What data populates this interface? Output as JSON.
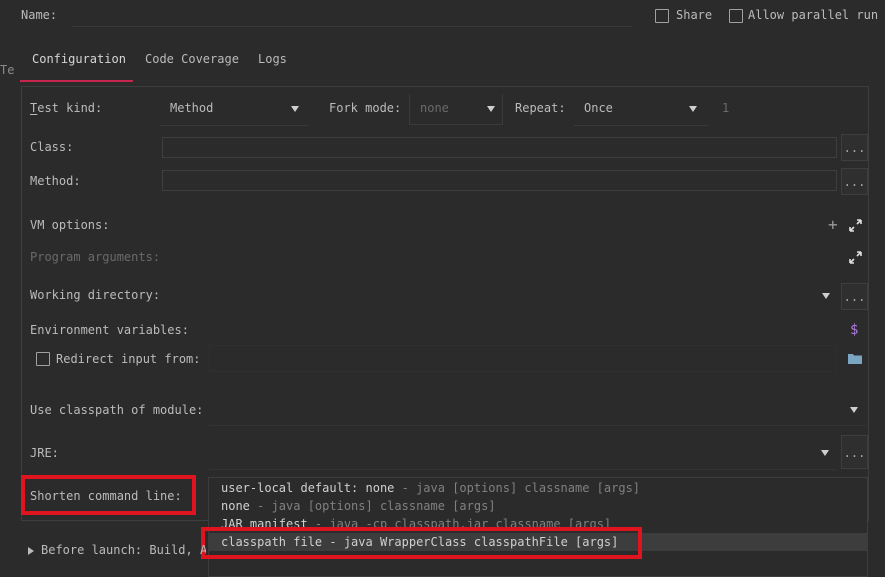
{
  "header": {
    "name_label": "Name:",
    "share_label": "Share",
    "allow_parallel_label": "Allow parallel run",
    "left_clip_text": "Te"
  },
  "tabs": [
    {
      "label": "Configuration"
    },
    {
      "label": "Code Coverage"
    },
    {
      "label": "Logs"
    }
  ],
  "form": {
    "test_kind_label": "Test kind:",
    "test_kind_value": "Method",
    "fork_mode_label": "Fork mode:",
    "fork_mode_value": "none",
    "repeat_label": "Repeat:",
    "repeat_value": "Once",
    "repeat_count": "1",
    "class_label": "Class:",
    "method_label": "Method:",
    "vm_options_label": "VM options:",
    "program_args_label": "Program arguments:",
    "working_dir_label": "Working directory:",
    "env_vars_label": "Environment variables:",
    "redirect_input_label": "Redirect input from:",
    "classpath_module_label": "Use classpath of module:",
    "jre_label": "JRE:",
    "shorten_cmd_label": "Shorten command line:",
    "dots": "...",
    "dollar": "$"
  },
  "shorten_options": [
    {
      "key": "user-local default: none",
      "desc": " - java [options] classname [args]"
    },
    {
      "key": "none",
      "desc": " - java [options] classname [args]"
    },
    {
      "key": "JAR manifest",
      "desc": " - java -cp classpath.jar classname [args]"
    },
    {
      "key": "classpath file",
      "desc": " - java WrapperClass classpathFile [args]"
    }
  ],
  "before_launch": "Before launch: Build, Ac",
  "colors": {
    "background": "#2b2b2b",
    "tab_underline": "#c7254e",
    "highlight_box": "#e0141e",
    "selected_row": "#3d3d3d"
  }
}
